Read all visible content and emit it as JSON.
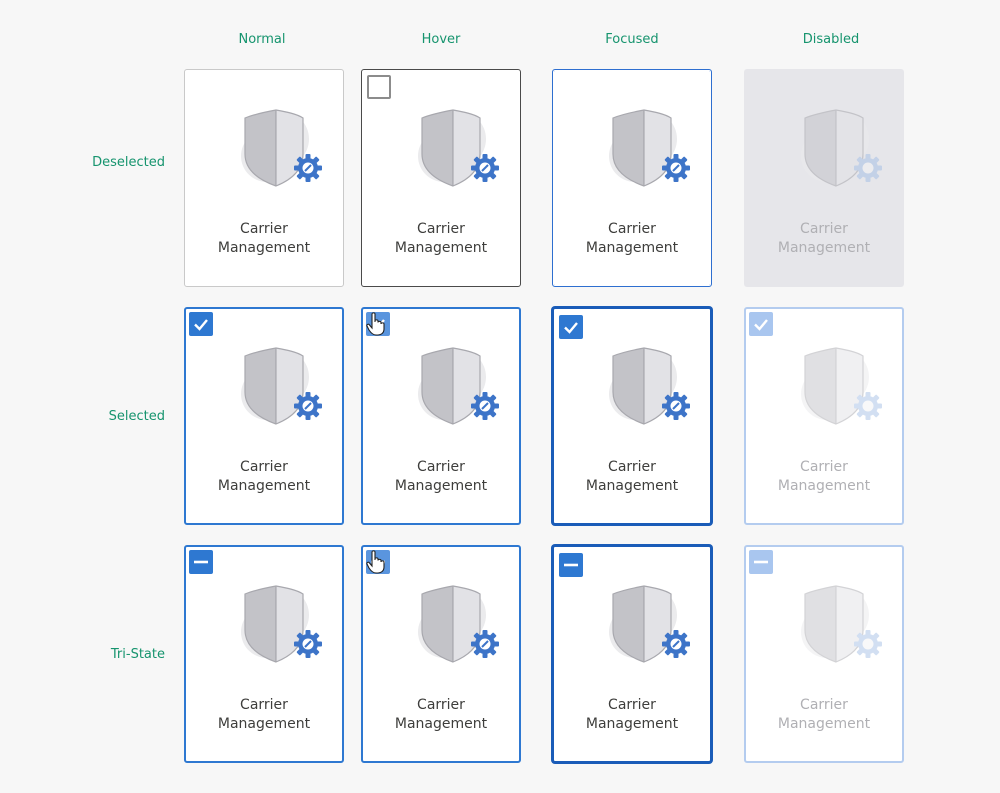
{
  "columns": [
    "Normal",
    "Hover",
    "Focused",
    "Disabled"
  ],
  "rows": [
    "Deselected",
    "Selected",
    "Tri-State"
  ],
  "tile": {
    "line1": "Carrier",
    "line2": "Management"
  },
  "colors": {
    "accent": "#2e78d1",
    "labels": "#16946e",
    "disabled_bg": "#e6e6ea"
  },
  "icons": [
    "shield-gear-icon",
    "checkmark-icon",
    "minus-icon",
    "hand-cursor-icon"
  ]
}
